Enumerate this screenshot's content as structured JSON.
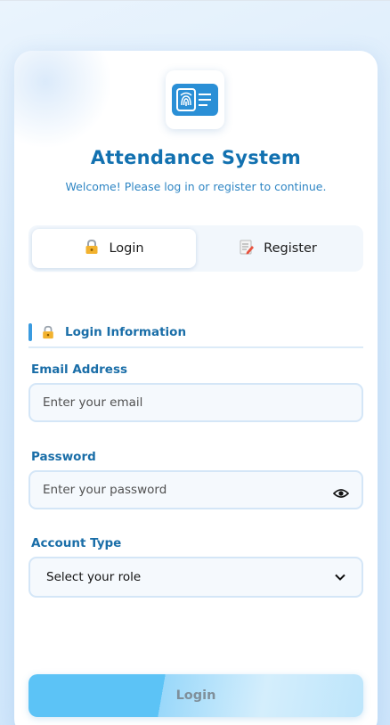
{
  "header": {
    "title": "Attendance System",
    "subtitle": "Welcome! Please log in or register to continue.",
    "logo_icon": "fingerprint-card-icon"
  },
  "tabs": [
    {
      "label": "Login",
      "icon": "lock-icon",
      "active": true
    },
    {
      "label": "Register",
      "icon": "memo-icon",
      "active": false
    }
  ],
  "section": {
    "title": "Login Information",
    "icon": "lock-icon"
  },
  "form": {
    "email": {
      "label": "Email Address",
      "placeholder": "Enter your email",
      "value": ""
    },
    "password": {
      "label": "Password",
      "placeholder": "Enter your password",
      "value": "",
      "toggle_icon": "eye-icon"
    },
    "account_type": {
      "label": "Account Type",
      "selected": "Select your role",
      "icon": "chevron-down-icon"
    }
  },
  "submit": {
    "label": "Login"
  },
  "colors": {
    "accent": "#1271b0",
    "accent_light": "#2f86c4",
    "button": "#5cc3f6",
    "field_border": "#d4e6f7"
  }
}
